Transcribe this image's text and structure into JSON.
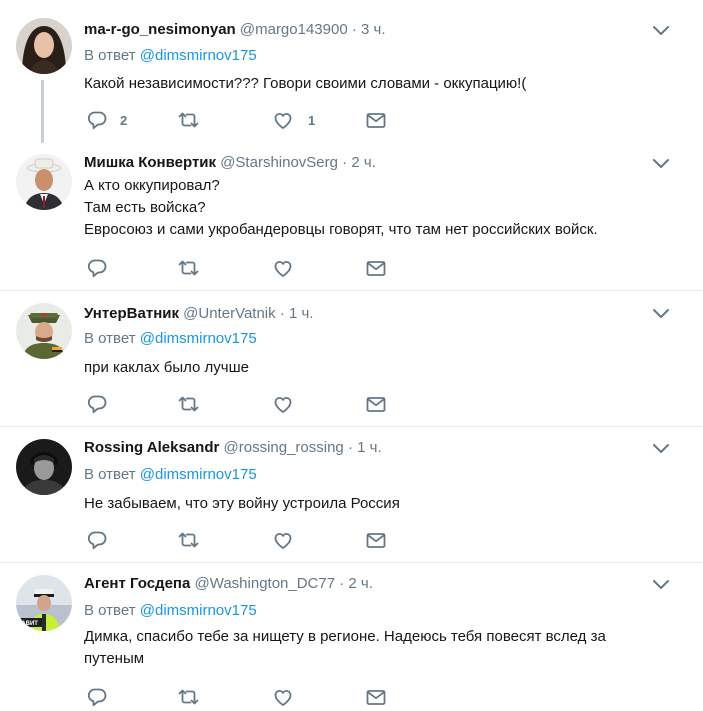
{
  "tweets": [
    {
      "name": "ma-r-go_nesimonyan",
      "handle": "@margo143900",
      "time": "3 ч.",
      "reply_label": "В ответ",
      "reply_to": "@dimsmirnov175",
      "lines": [
        "Какой независимости??? Говори своими словами - оккупацию!("
      ],
      "reply_count": "2",
      "like_count": "1"
    },
    {
      "name": "Мишка Конвертик",
      "handle": "@StarshinovSerg",
      "time": "2 ч.",
      "lines": [
        "А кто оккупировал?",
        "Там есть войска?",
        "Евросоюз и сами укробандеровцы говорят, что там нет российских войск."
      ]
    },
    {
      "name": "УнтерВатник",
      "handle": "@UnterVatnik",
      "time": "1 ч.",
      "reply_label": "В ответ",
      "reply_to": "@dimsmirnov175",
      "lines": [
        "при каклах было лучше"
      ]
    },
    {
      "name": "Rossing Aleksandr",
      "handle": "@rossing_rossing",
      "time": "1 ч.",
      "reply_label": "В ответ",
      "reply_to": "@dimsmirnov175",
      "lines": [
        "Не забываем, что эту войну устроила Россия"
      ]
    },
    {
      "name": "Агент Госдепа",
      "handle": "@Washington_DC77",
      "time": "2 ч.",
      "reply_label": "В ответ",
      "reply_to": "@dimsmirnov175",
      "lines": [
        "Димка, спасибо тебе за нищету в регионе. Надеюсь тебя повесят вслед за",
        "путеным"
      ],
      "avatar_badge": "НАВИТ"
    }
  ],
  "dot": "·",
  "icons": {
    "reply": "reply-icon",
    "retweet": "retweet-icon",
    "like": "heart-icon",
    "dm": "envelope-icon",
    "caret": "chevron-down-icon"
  },
  "colors": {
    "link": "#1b95e0",
    "secondary": "#657786",
    "text": "#14171a",
    "separator": "#e6ecf0",
    "thread_line": "#c4cfd6"
  }
}
